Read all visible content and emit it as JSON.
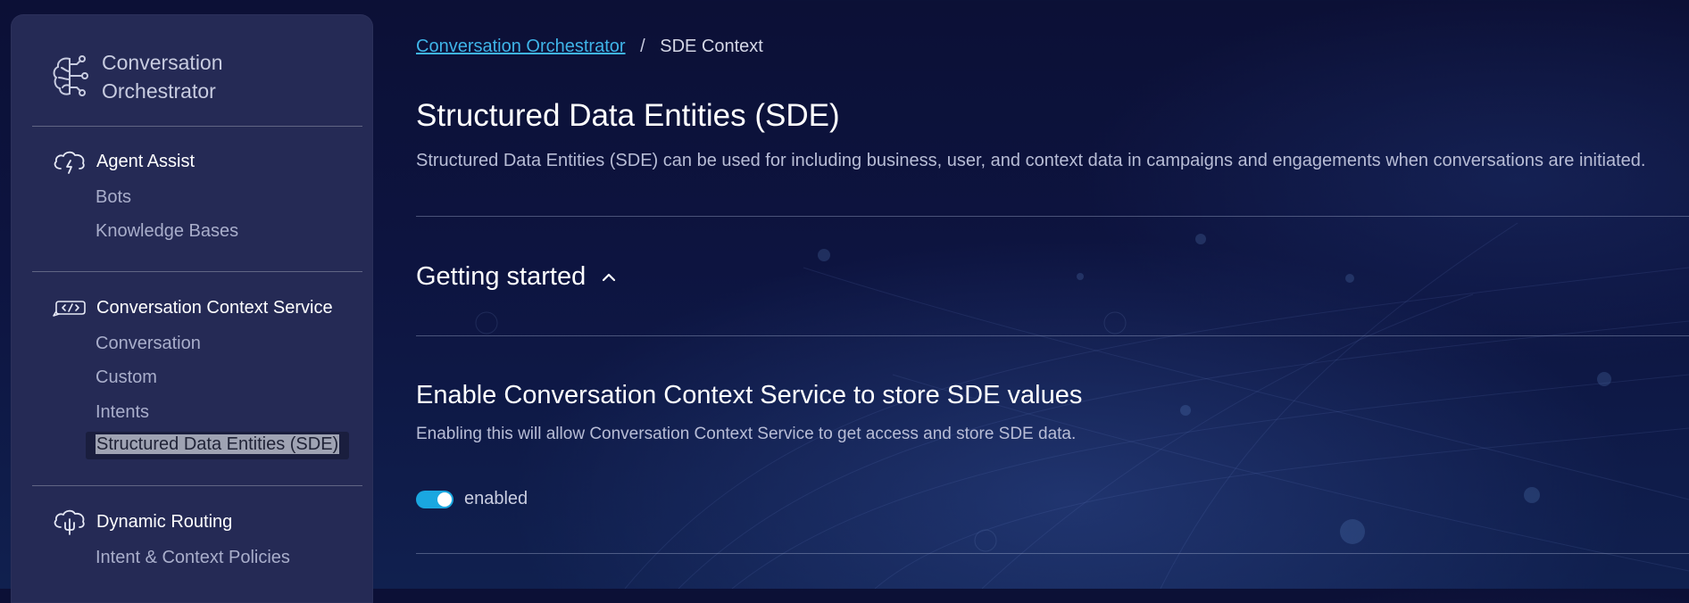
{
  "colors": {
    "accent": "#1aa7e0",
    "link": "#3fb4e8",
    "sidebar_bg": "#252a55",
    "page_bg": "#0d1440"
  },
  "sidebar": {
    "brand": {
      "icon": "brain-circuit-icon",
      "line1": "Conversation",
      "line2": "Orchestrator"
    },
    "groups": [
      {
        "icon": "cloud-lightning-icon",
        "title": "Agent Assist",
        "items": [
          "Bots",
          "Knowledge Bases"
        ]
      },
      {
        "icon": "code-bubble-icon",
        "title": "Conversation Context Service",
        "items": [
          "Conversation",
          "Custom",
          "Intents",
          "Structured Data Entities (SDE)"
        ],
        "active_item": "Structured Data Entities (SDE)"
      },
      {
        "icon": "cloud-routing-icon",
        "title": "Dynamic Routing",
        "items": [
          "Intent & Context Policies"
        ]
      }
    ]
  },
  "breadcrumb": {
    "parent": "Conversation Orchestrator",
    "separator": "/",
    "current": "SDE Context"
  },
  "page": {
    "title": "Structured Data Entities (SDE)",
    "description": "Structured Data Entities (SDE) can be used for including business, user, and context data in campaigns and engagements when conversations are initiated."
  },
  "getting_started": {
    "label": "Getting started",
    "icon": "chevron-up-icon",
    "expanded": true
  },
  "setting": {
    "title": "Enable Conversation Context Service to store SDE values",
    "description": "Enabling this will allow Conversation Context Service to get access and store SDE data.",
    "toggle_on": true,
    "toggle_label": "enabled"
  }
}
